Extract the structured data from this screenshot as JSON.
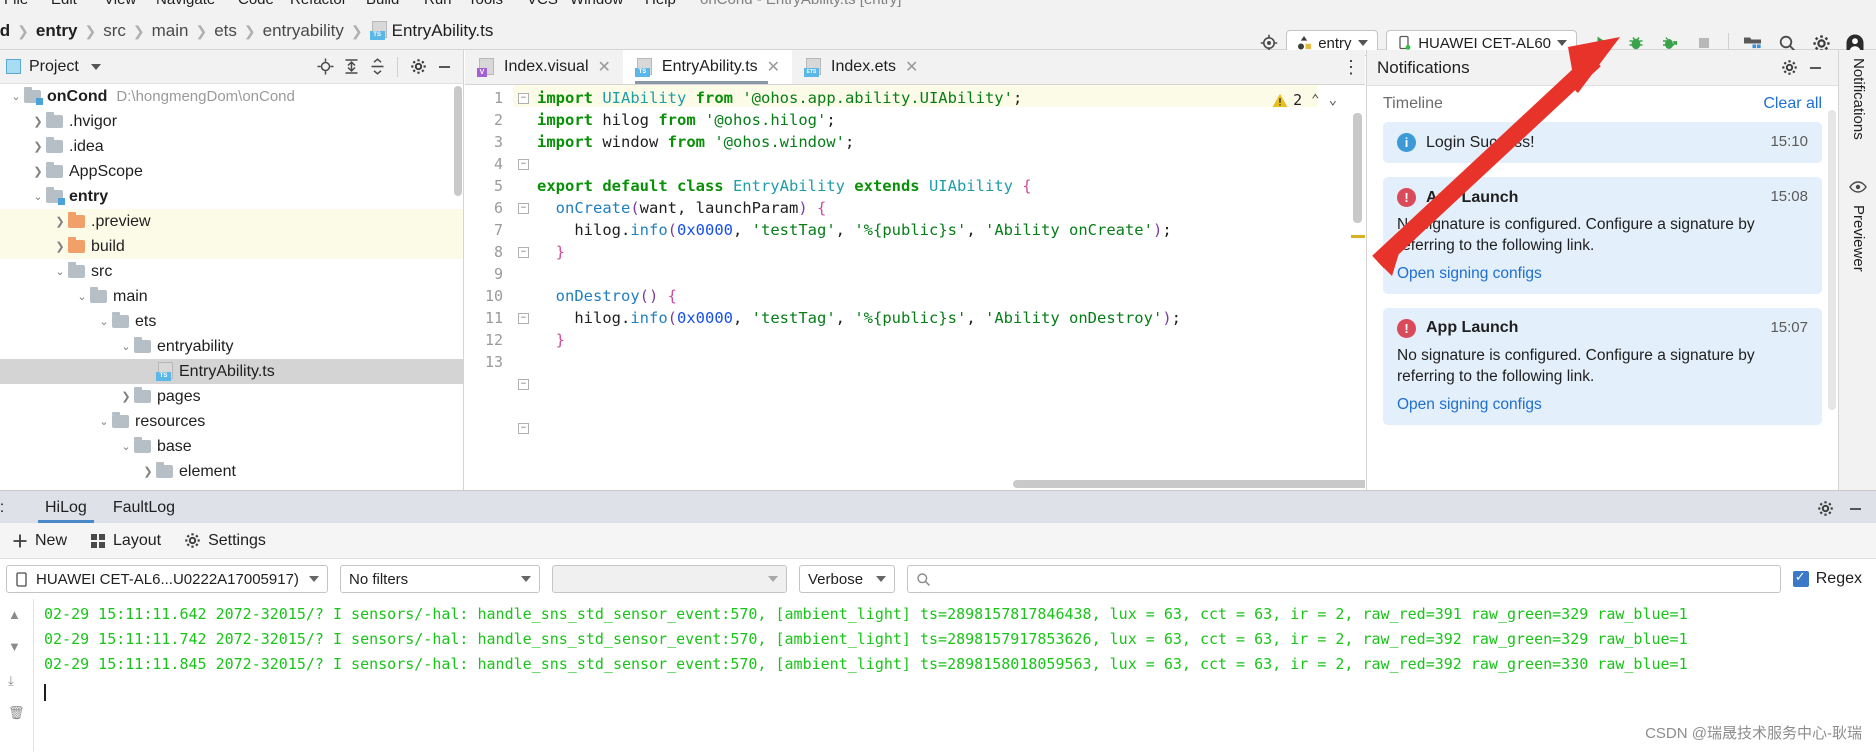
{
  "menu": {
    "items": [
      "File",
      "Edit",
      "View",
      "Navigate",
      "Code",
      "Refactor",
      "Build",
      "Run",
      "Tools",
      "VCS",
      "Window",
      "Help"
    ],
    "window_title": "onCond - EntryAbility.ts [entry]"
  },
  "breadcrumb": {
    "items": [
      "ond",
      "entry",
      "src",
      "main",
      "ets",
      "entryability",
      "EntryAbility.ts"
    ]
  },
  "toolbar": {
    "module_label": "entry",
    "device_label": "HUAWEI CET-AL60",
    "icons": [
      "target-icon",
      "run-icon",
      "debug-icon",
      "attach-debugger-icon",
      "stop-icon",
      "device-manager-icon",
      "search-icon",
      "settings-icon",
      "account-icon"
    ]
  },
  "project_panel": {
    "title": "Project",
    "header_icons": [
      "locate-icon",
      "expand-all-icon",
      "collapse-all-icon",
      "gear-icon",
      "minimize-icon"
    ],
    "tree": [
      {
        "label": "onCond",
        "path": "D:\\hongmengDom\\onCond",
        "depth": 0,
        "arrow": "down",
        "icon": "module-folder",
        "bold": true,
        "state": "normal"
      },
      {
        "label": ".hvigor",
        "path": "",
        "depth": 1,
        "arrow": "right",
        "icon": "folder",
        "bold": false,
        "state": "normal"
      },
      {
        "label": ".idea",
        "path": "",
        "depth": 1,
        "arrow": "right",
        "icon": "folder",
        "bold": false,
        "state": "normal"
      },
      {
        "label": "AppScope",
        "path": "",
        "depth": 1,
        "arrow": "right",
        "icon": "folder",
        "bold": false,
        "state": "normal"
      },
      {
        "label": "entry",
        "path": "",
        "depth": 1,
        "arrow": "down",
        "icon": "module-folder",
        "bold": true,
        "state": "normal"
      },
      {
        "label": ".preview",
        "path": "",
        "depth": 2,
        "arrow": "right",
        "icon": "folder-orange",
        "bold": false,
        "state": "highlight"
      },
      {
        "label": "build",
        "path": "",
        "depth": 2,
        "arrow": "right",
        "icon": "folder-orange",
        "bold": false,
        "state": "highlight"
      },
      {
        "label": "src",
        "path": "",
        "depth": 2,
        "arrow": "down",
        "icon": "folder",
        "bold": false,
        "state": "normal"
      },
      {
        "label": "main",
        "path": "",
        "depth": 3,
        "arrow": "down",
        "icon": "folder",
        "bold": false,
        "state": "normal"
      },
      {
        "label": "ets",
        "path": "",
        "depth": 4,
        "arrow": "down",
        "icon": "folder",
        "bold": false,
        "state": "normal"
      },
      {
        "label": "entryability",
        "path": "",
        "depth": 5,
        "arrow": "down",
        "icon": "folder",
        "bold": false,
        "state": "normal"
      },
      {
        "label": "EntryAbility.ts",
        "path": "",
        "depth": 6,
        "arrow": "none",
        "icon": "ts-file",
        "bold": false,
        "state": "selected"
      },
      {
        "label": "pages",
        "path": "",
        "depth": 5,
        "arrow": "right",
        "icon": "folder",
        "bold": false,
        "state": "normal"
      },
      {
        "label": "resources",
        "path": "",
        "depth": 4,
        "arrow": "down",
        "icon": "folder",
        "bold": false,
        "state": "normal"
      },
      {
        "label": "base",
        "path": "",
        "depth": 5,
        "arrow": "down",
        "icon": "folder",
        "bold": false,
        "state": "normal"
      },
      {
        "label": "element",
        "path": "",
        "depth": 6,
        "arrow": "right",
        "icon": "folder",
        "bold": false,
        "state": "normal"
      }
    ]
  },
  "editor": {
    "tabs": [
      {
        "label": "Index.visual",
        "icon": "visual-file-icon",
        "active": false
      },
      {
        "label": "EntryAbility.ts",
        "icon": "ts-file-icon",
        "active": true
      },
      {
        "label": "Index.ets",
        "icon": "ets-file-icon",
        "active": false
      }
    ],
    "warning_count": "2",
    "line_numbers": [
      "1",
      "2",
      "3",
      "4",
      "5",
      "6",
      "7",
      "8",
      "9",
      "10",
      "11",
      "12",
      "13"
    ],
    "code_lines": [
      {
        "n": 1,
        "tokens": [
          [
            "kw",
            "import "
          ],
          [
            "cls",
            "UIAbility"
          ],
          [
            "kw",
            " from "
          ],
          [
            "str",
            "'@ohos.app.ability.UIAbility'"
          ],
          [
            "id",
            ";"
          ]
        ]
      },
      {
        "n": 2,
        "tokens": [
          [
            "kw",
            "import "
          ],
          [
            "id",
            "hilog"
          ],
          [
            "kw",
            " from "
          ],
          [
            "str",
            "'@ohos.hilog'"
          ],
          [
            "id",
            ";"
          ]
        ]
      },
      {
        "n": 3,
        "tokens": [
          [
            "kw",
            "import "
          ],
          [
            "id",
            "window"
          ],
          [
            "kw",
            " from "
          ],
          [
            "str",
            "'@ohos.window'"
          ],
          [
            "id",
            ";"
          ]
        ]
      },
      {
        "n": 4,
        "tokens": []
      },
      {
        "n": 5,
        "tokens": [
          [
            "kw",
            "export default class "
          ],
          [
            "cls",
            "EntryAbility"
          ],
          [
            "kw",
            " extends "
          ],
          [
            "cls",
            "UIAbility"
          ],
          [
            "brace",
            " {"
          ]
        ]
      },
      {
        "n": 6,
        "tokens": [
          [
            "id",
            "  "
          ],
          [
            "fn",
            "onCreate"
          ],
          [
            "par",
            "("
          ],
          [
            "id",
            "want, launchParam"
          ],
          [
            "par",
            ")"
          ],
          [
            "brace",
            " {"
          ]
        ]
      },
      {
        "n": 7,
        "tokens": [
          [
            "id",
            "    hilog."
          ],
          [
            "fn",
            "info"
          ],
          [
            "par",
            "("
          ],
          [
            "num",
            "0x0000"
          ],
          [
            "id",
            ", "
          ],
          [
            "str",
            "'testTag'"
          ],
          [
            "id",
            ", "
          ],
          [
            "str",
            "'%{public}s'"
          ],
          [
            "id",
            ", "
          ],
          [
            "str",
            "'Ability onCreate'"
          ],
          [
            "par",
            ")"
          ],
          [
            "id",
            ";"
          ]
        ]
      },
      {
        "n": 8,
        "tokens": [
          [
            "brace",
            "  }"
          ]
        ]
      },
      {
        "n": 9,
        "tokens": []
      },
      {
        "n": 10,
        "tokens": [
          [
            "id",
            "  "
          ],
          [
            "fn",
            "onDestroy"
          ],
          [
            "par",
            "()"
          ],
          [
            "brace",
            " {"
          ]
        ]
      },
      {
        "n": 11,
        "tokens": [
          [
            "id",
            "    hilog."
          ],
          [
            "fn",
            "info"
          ],
          [
            "par",
            "("
          ],
          [
            "num",
            "0x0000"
          ],
          [
            "id",
            ", "
          ],
          [
            "str",
            "'testTag'"
          ],
          [
            "id",
            ", "
          ],
          [
            "str",
            "'%{public}s'"
          ],
          [
            "id",
            ", "
          ],
          [
            "str",
            "'Ability onDestroy'"
          ],
          [
            "par",
            ")"
          ],
          [
            "id",
            ";"
          ]
        ]
      },
      {
        "n": 12,
        "tokens": [
          [
            "brace",
            "  }"
          ]
        ]
      },
      {
        "n": 13,
        "tokens": []
      }
    ]
  },
  "notifications": {
    "title": "Notifications",
    "timeline_label": "Timeline",
    "clear_all_label": "Clear all",
    "cards": [
      {
        "kind": "info",
        "badge": "i",
        "title": "Login Success!",
        "bold": false,
        "time": "15:10",
        "body": "",
        "link": ""
      },
      {
        "kind": "error",
        "badge": "!",
        "title": "App Launch",
        "bold": true,
        "time": "15:08",
        "body": "No signature is configured. Configure a signature by referring to the following link.",
        "link": "Open signing configs"
      },
      {
        "kind": "error",
        "badge": "!",
        "title": "App Launch",
        "bold": true,
        "time": "15:07",
        "body": "No signature is configured. Configure a signature by referring to the following link.",
        "link": "Open signing configs"
      }
    ]
  },
  "right_strip": {
    "items": [
      "Notifications",
      "Previewer"
    ]
  },
  "bottom_panel": {
    "log_label": "og:",
    "tabs": [
      {
        "label": "HiLog",
        "active": true
      },
      {
        "label": "FaultLog",
        "active": false
      }
    ],
    "toolbar": [
      {
        "label": "New",
        "icon": "plus-icon"
      },
      {
        "label": "Layout",
        "icon": "layout-icon"
      },
      {
        "label": "Settings",
        "icon": "gear-icon"
      }
    ],
    "header_icons": [
      "gear-icon",
      "minimize-icon"
    ],
    "filters": {
      "device": "HUAWEI CET-AL6...U0222A17005917)",
      "process": "No filters",
      "extra": "",
      "level": "Verbose",
      "search_placeholder": "",
      "search_value": "",
      "regex_label": "Regex",
      "regex_checked": true
    },
    "log_lines": [
      "02-29 15:11:11.642 2072-32015/? I sensors/-hal: handle_sns_std_sensor_event:570, [ambient_light] ts=2898157817846438, lux = 63, cct = 63, ir = 2, raw_red=391 raw_green=329 raw_blue=1",
      "02-29 15:11:11.742 2072-32015/? I sensors/-hal: handle_sns_std_sensor_event:570, [ambient_light] ts=2898157917853626, lux = 63, cct = 63, ir = 2, raw_red=392 raw_green=329 raw_blue=1",
      "02-29 15:11:11.845 2072-32015/? I sensors/-hal: handle_sns_std_sensor_event:570, [ambient_light] ts=2898158018059563, lux = 63, cct = 63, ir = 2, raw_red=392 raw_green=330 raw_blue=1"
    ]
  },
  "watermark": "CSDN @瑞晟技术服务中心-耿瑞",
  "colors": {
    "accent_blue": "#4a89c8",
    "link_blue": "#1f6fd0",
    "log_green": "#19c419",
    "arrow_red": "#e8332a",
    "error_red": "#d94a5a",
    "info_blue": "#3c9ad6",
    "warn_yellow": "#d8b020"
  }
}
